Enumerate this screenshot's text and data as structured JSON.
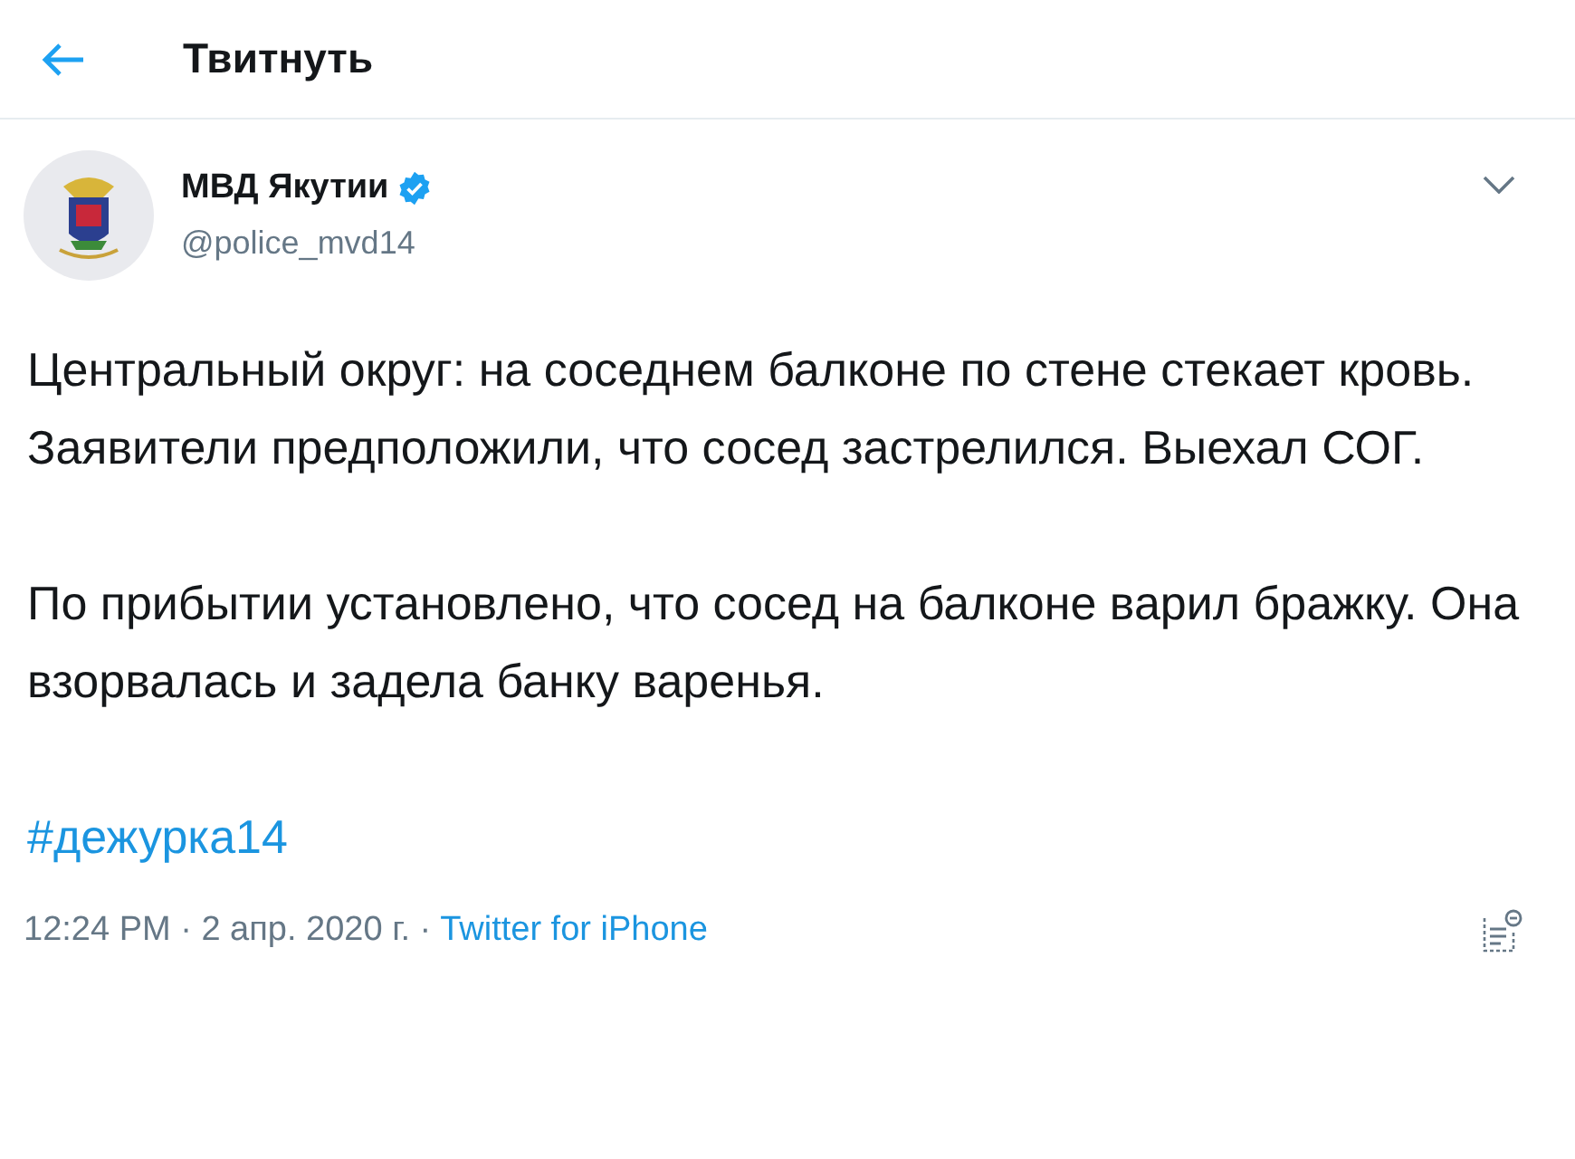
{
  "header": {
    "title": "Твитнуть"
  },
  "author": {
    "name": "МВД Якутии",
    "verified": true,
    "handle": "@police_mvd14"
  },
  "paragraphs": [
    "Центральный округ: на соседнем балконе по стене стекает кровь. Заявители предположили, что сосед застрелился. Выехал СОГ.",
    "По прибытии установлено, что сосед на балконе варил бражку. Она взорвалась и задела банку варенья."
  ],
  "hashtag": "#дежурка14",
  "meta": {
    "time": "12:24 PM · 2 апр. 2020 г. ·",
    "source": "Twitter for iPhone"
  }
}
